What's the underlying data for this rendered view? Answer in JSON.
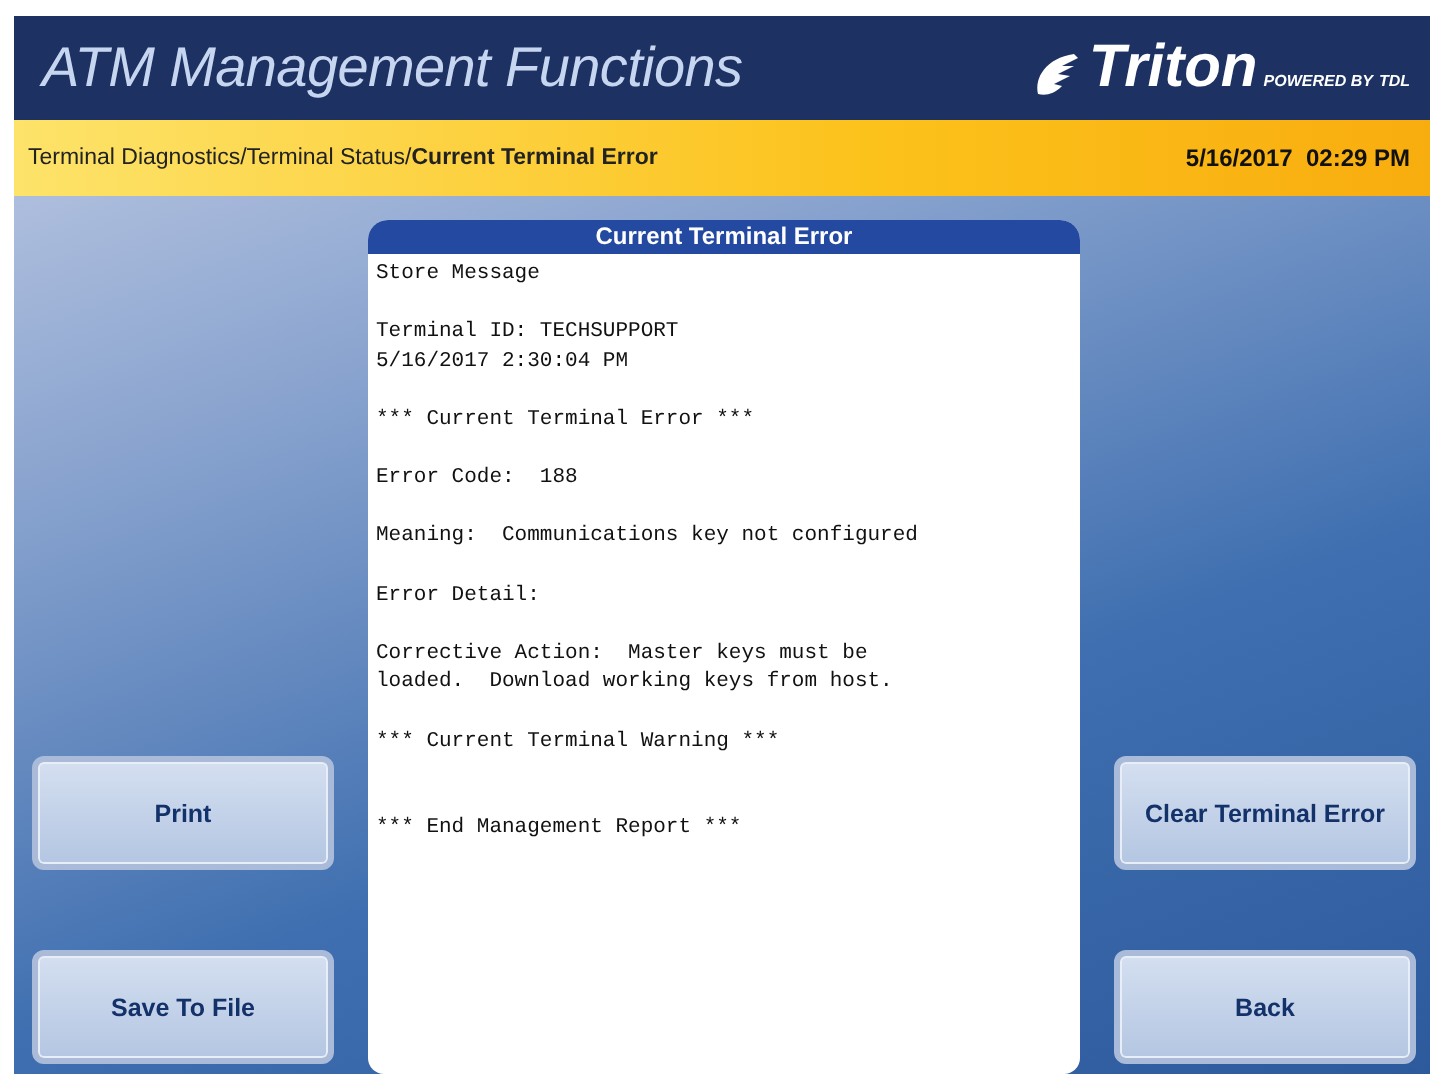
{
  "header": {
    "title": "ATM Management Functions",
    "logo": {
      "brand": "Triton",
      "tagline": "POWERED BY",
      "tagline_brand": "TDL"
    }
  },
  "breadcrumb": {
    "path": "Terminal Diagnostics/Terminal Status/",
    "current": "Current Terminal Error",
    "datetime": "5/16/2017  02:29 PM"
  },
  "report": {
    "title": "Current Terminal Error",
    "paragraphs": [
      {
        "lines": [
          "Store Message"
        ]
      },
      {
        "lines": [
          "Terminal ID: TECHSUPPORT",
          "5/16/2017 2:30:04 PM"
        ]
      },
      {
        "lines": [
          "*** Current Terminal Error ***"
        ]
      },
      {
        "lines": [
          "Error Code:  188"
        ]
      },
      {
        "lines": [
          "Meaning:  Communications key not configured"
        ]
      },
      {
        "lines": [
          "Error Detail:"
        ]
      },
      {
        "lines": [
          "Corrective Action:  Master keys must be",
          "loaded.  Download working keys from host."
        ]
      },
      {
        "lines": [
          "*** Current Terminal Warning ***"
        ]
      },
      {
        "lines": [
          "*** End Management Report ***"
        ]
      }
    ]
  },
  "left_buttons": [
    "Print",
    "Save To File"
  ],
  "right_buttons": [
    "Clear Terminal Error",
    "Back"
  ]
}
